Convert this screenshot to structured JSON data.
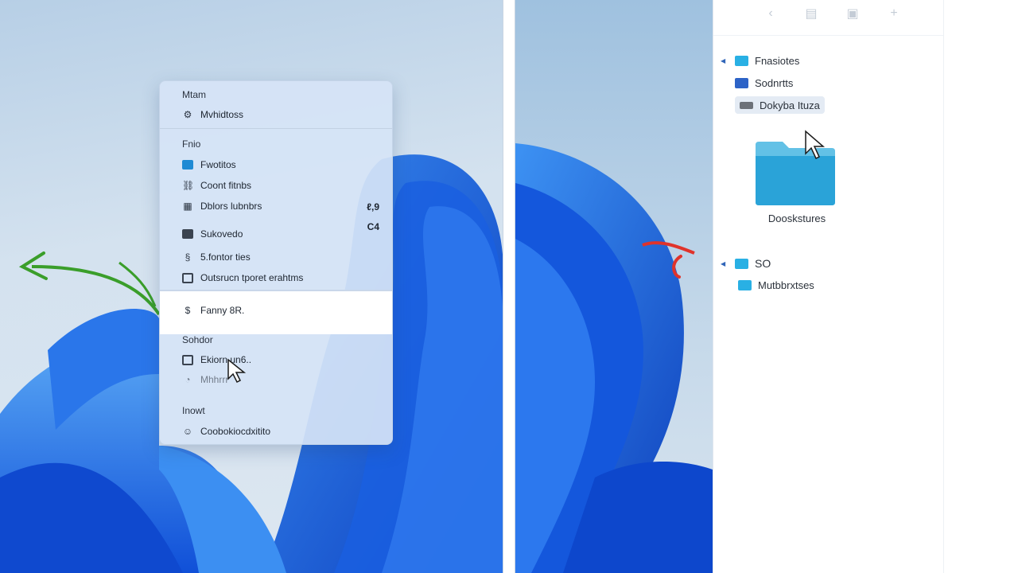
{
  "context_menu": {
    "sections": [
      {
        "header": "Mtam",
        "items": [
          {
            "label": "Mvhidtoss",
            "icon": "settings-icon"
          }
        ]
      },
      {
        "header": "Fnio",
        "items": [
          {
            "label": "Fwotitos",
            "icon": "folder-icon"
          },
          {
            "label": "Coont fitnbs",
            "icon": "link-icon"
          },
          {
            "label": "Dblors lubnbrs",
            "icon": "grid-icon",
            "shortcut": "ℓ,9"
          },
          {
            "label": "Sukovedo",
            "icon": "camera-icon",
            "shortcut": "C4"
          },
          {
            "label": "5.fontor ties",
            "icon": "font-icon"
          },
          {
            "label": "Outsrucn tporet erahtms",
            "icon": "document-icon"
          },
          {
            "label": "Fanny 8R.",
            "icon": "dollar-icon"
          }
        ]
      },
      {
        "header": "Sohdor",
        "items": [
          {
            "label": "Ekiorn un6..",
            "icon": "copy-icon"
          },
          {
            "label": "Mhhrrr",
            "icon": "clock-icon"
          }
        ]
      },
      {
        "header": "Inowt",
        "items": [
          {
            "label": "Coobokiocdxitito",
            "icon": "emoji-icon"
          }
        ]
      }
    ]
  },
  "explorer": {
    "toolbar": [
      "back-icon",
      "list-view-icon",
      "save-icon",
      "add-icon"
    ],
    "tree": [
      {
        "label": "Fnasiotes",
        "color": "#29b0e4",
        "expandable": true
      },
      {
        "label": "Sodnrtts",
        "color": "#2d63c7",
        "expandable": false
      },
      {
        "label": "Dokyba Ituza",
        "color": "#6d7178",
        "expandable": false,
        "selected": true
      }
    ],
    "big_folder_label": "Dooskstures",
    "tree2": [
      {
        "label": "SO",
        "color": "#29b0e4",
        "expandable": true
      },
      {
        "label": "Mutbbrxtses",
        "color": "#29b0e4",
        "expandable": false
      }
    ]
  },
  "colors": {
    "accent": "#1e6de0",
    "arrow_green": "#3a9e2a",
    "arrow_red": "#e0332b"
  }
}
